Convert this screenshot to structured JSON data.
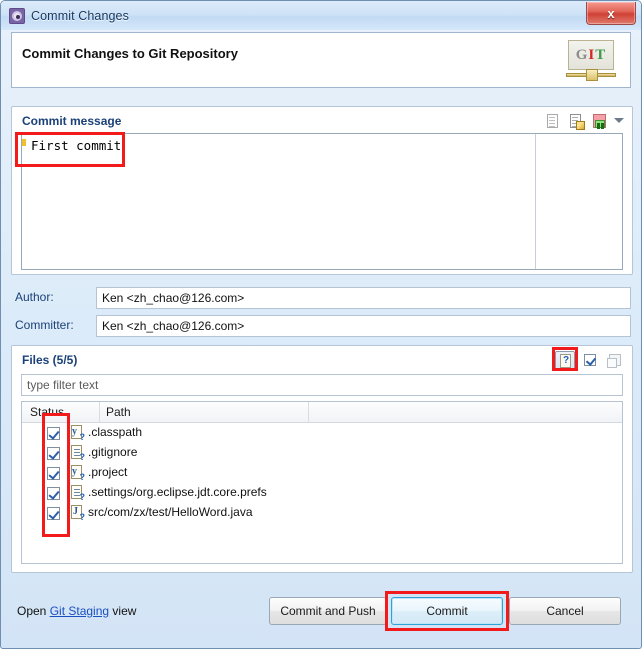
{
  "window": {
    "title": "Commit Changes",
    "title_icon": "gear-icon",
    "close_label": "x"
  },
  "banner": {
    "heading": "Commit Changes to Git Repository",
    "logo_g": "G",
    "logo_i": "I",
    "logo_t": "T"
  },
  "commit_message": {
    "group_title": "Commit message",
    "value": "First commit",
    "toolbar": [
      {
        "name": "add-signed-off-by-icon",
        "label": "Add Signed-off-by"
      },
      {
        "name": "add-change-id-icon",
        "label": "Add Change-Id"
      },
      {
        "name": "amend-previous-commit-icon",
        "label": "Amend Previous Commit"
      },
      {
        "name": "chevron-down-icon",
        "label": "More"
      }
    ]
  },
  "author": {
    "label": "Author:",
    "value": "Ken <zh_chao@126.com>"
  },
  "committer": {
    "label": "Committer:",
    "value": "Ken <zh_chao@126.com>"
  },
  "files": {
    "group_title": "Files (5/5)",
    "selected_count": 5,
    "total_count": 5,
    "toolbar": [
      {
        "name": "show-untracked-files-icon",
        "label": "?",
        "pressed": true
      },
      {
        "name": "select-all-icon",
        "label": "Select All",
        "pressed": false
      },
      {
        "name": "deselect-all-icon",
        "label": "Deselect All",
        "pressed": false
      }
    ],
    "filter_placeholder": "type filter text",
    "filter_value": "",
    "columns": [
      "Status",
      "Path",
      ""
    ],
    "rows": [
      {
        "checked": true,
        "icon": "xml-file-untracked-icon",
        "path": ".classpath"
      },
      {
        "checked": true,
        "icon": "text-file-untracked-icon",
        "path": ".gitignore"
      },
      {
        "checked": true,
        "icon": "xml-file-untracked-icon",
        "path": ".project"
      },
      {
        "checked": true,
        "icon": "text-file-untracked-icon",
        "path": ".settings/org.eclipse.jdt.core.prefs"
      },
      {
        "checked": true,
        "icon": "java-file-untracked-icon",
        "path": "src/com/zx/test/HelloWord.java"
      }
    ]
  },
  "footer": {
    "open_prefix": "Open ",
    "link_text": "Git Staging",
    "open_suffix": " view",
    "buttons": {
      "commit_and_push": "Commit and Push",
      "commit": "Commit",
      "cancel": "Cancel"
    }
  },
  "colors": {
    "accent_blue": "#1b4178",
    "link_blue": "#1b4fbf",
    "annotation_red": "#f21a1a",
    "default_button_border": "#2ea3d8",
    "close_button_red": "#cf4236"
  }
}
